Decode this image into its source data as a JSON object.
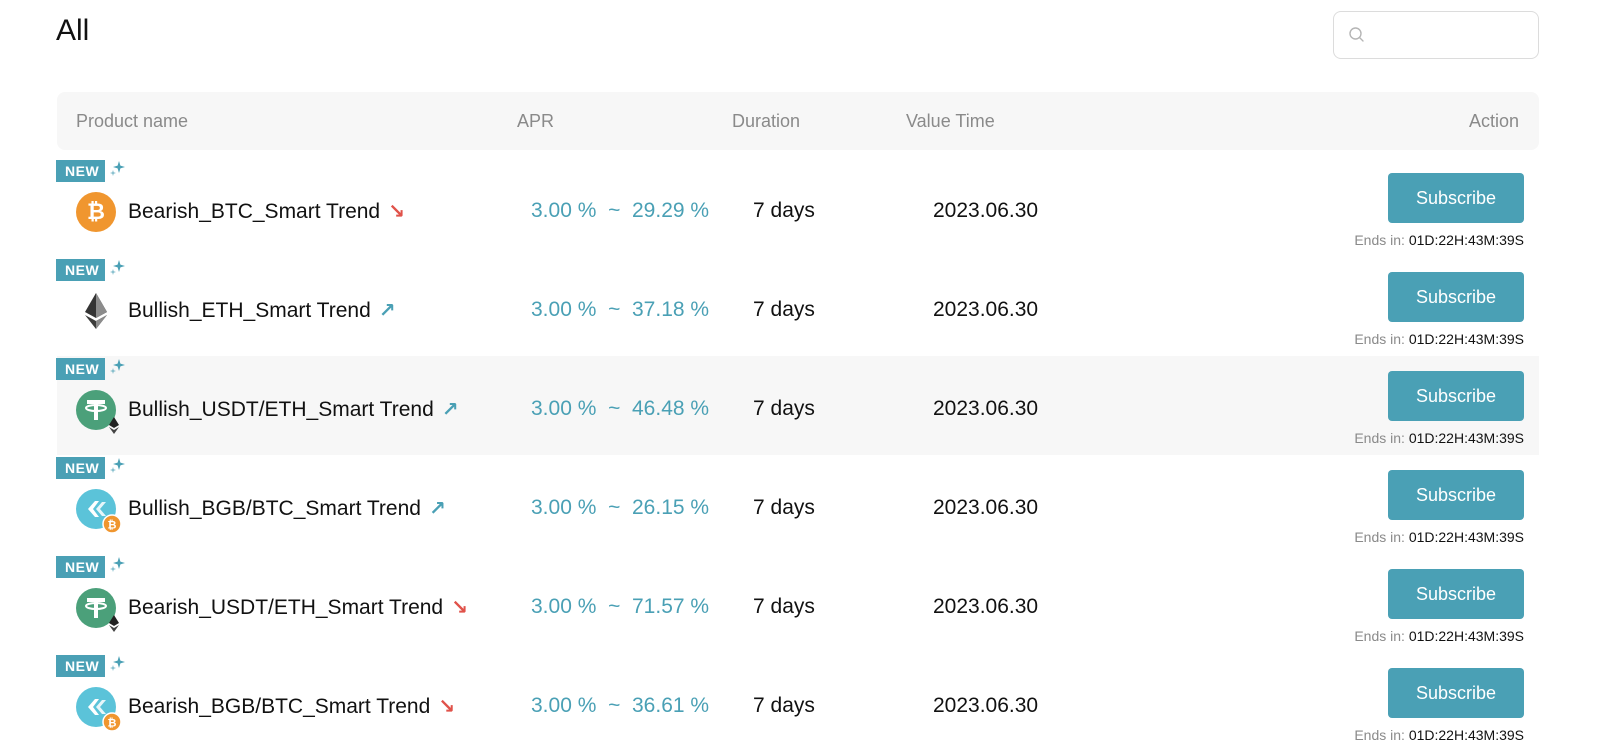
{
  "page": {
    "title": "All"
  },
  "search": {
    "placeholder": ""
  },
  "table": {
    "headers": {
      "product_name": "Product name",
      "apr": "APR",
      "duration": "Duration",
      "value_time": "Value Time",
      "action": "Action"
    },
    "rows": [
      {
        "badge": "NEW",
        "name": "Bearish_BTC_Smart Trend",
        "trend": "down",
        "coin": "btc-icon",
        "apr_min": "3.00 %",
        "apr_sep": "~",
        "apr_max": "29.29 %",
        "duration": "7 days",
        "value_time": "2023.06.30",
        "button": "Subscribe",
        "ends_label": "Ends in:",
        "ends_value": "01D:22H:43M:39S"
      },
      {
        "badge": "NEW",
        "name": "Bullish_ETH_Smart Trend",
        "trend": "up",
        "coin": "eth-icon",
        "apr_min": "3.00 %",
        "apr_sep": "~",
        "apr_max": "37.18 %",
        "duration": "7 days",
        "value_time": "2023.06.30",
        "button": "Subscribe",
        "ends_label": "Ends in:",
        "ends_value": "01D:22H:43M:39S"
      },
      {
        "badge": "NEW",
        "name": "Bullish_USDT/ETH_Smart Trend",
        "trend": "up",
        "coin": "usdt-eth-icon",
        "apr_min": "3.00 %",
        "apr_sep": "~",
        "apr_max": "46.48 %",
        "duration": "7 days",
        "value_time": "2023.06.30",
        "button": "Subscribe",
        "ends_label": "Ends in:",
        "ends_value": "01D:22H:43M:39S"
      },
      {
        "badge": "NEW",
        "name": "Bullish_BGB/BTC_Smart Trend",
        "trend": "up",
        "coin": "bgb-btc-icon",
        "apr_min": "3.00 %",
        "apr_sep": "~",
        "apr_max": "26.15 %",
        "duration": "7 days",
        "value_time": "2023.06.30",
        "button": "Subscribe",
        "ends_label": "Ends in:",
        "ends_value": "01D:22H:43M:39S"
      },
      {
        "badge": "NEW",
        "name": "Bearish_USDT/ETH_Smart Trend",
        "trend": "down",
        "coin": "usdt-eth-icon",
        "apr_min": "3.00 %",
        "apr_sep": "~",
        "apr_max": "71.57 %",
        "duration": "7 days",
        "value_time": "2023.06.30",
        "button": "Subscribe",
        "ends_label": "Ends in:",
        "ends_value": "01D:22H:43M:39S"
      },
      {
        "badge": "NEW",
        "name": "Bearish_BGB/BTC_Smart Trend",
        "trend": "down",
        "coin": "bgb-btc-icon",
        "apr_min": "3.00 %",
        "apr_sep": "~",
        "apr_max": "36.61 %",
        "duration": "7 days",
        "value_time": "2023.06.30",
        "button": "Subscribe",
        "ends_label": "Ends in:",
        "ends_value": "01D:22H:43M:39S"
      }
    ]
  },
  "colors": {
    "accent": "#4aa0b5",
    "down": "#e0524a",
    "header_bg": "#f7f7f7",
    "btc": "#f0962f",
    "usdt": "#4ba07a",
    "bgb": "#5bc3d9"
  }
}
